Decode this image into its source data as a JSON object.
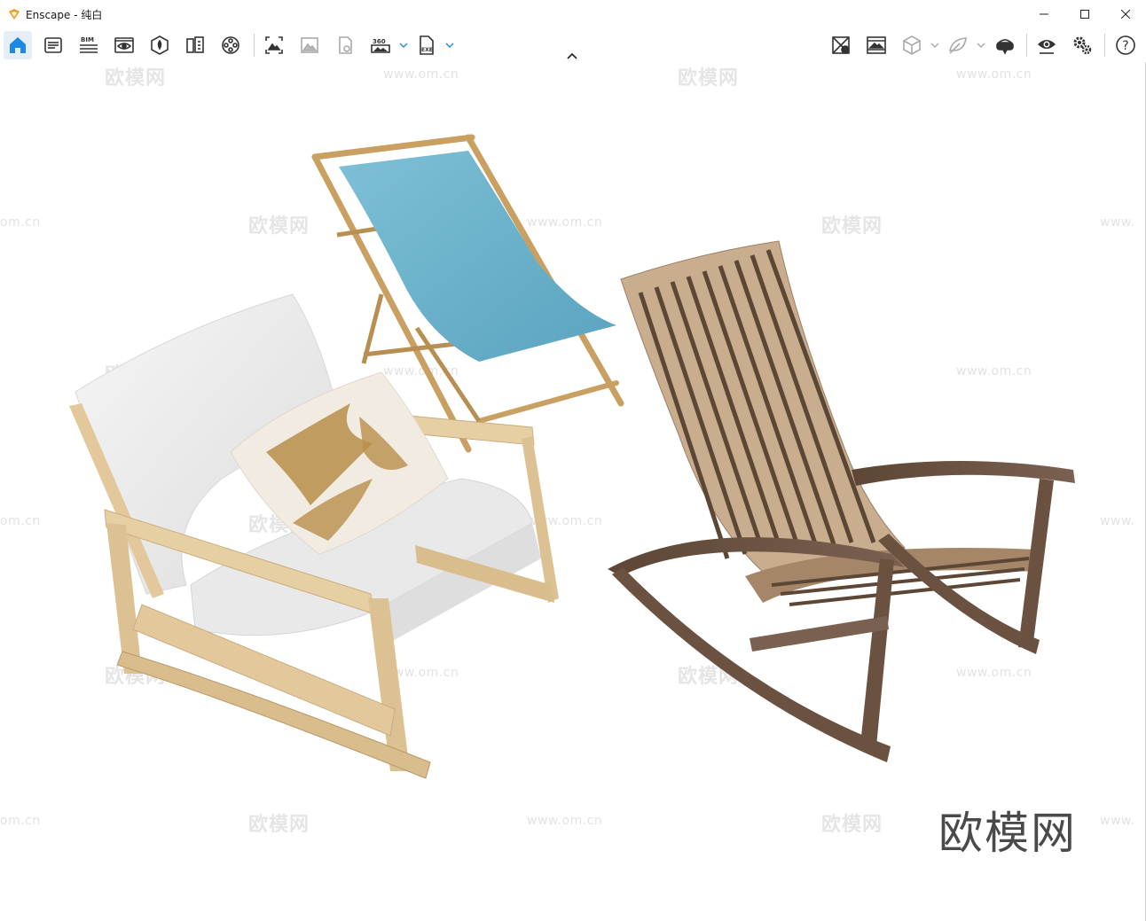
{
  "window": {
    "title": "Enscape - 纯白",
    "controls": [
      "minimize",
      "maximize",
      "close"
    ]
  },
  "toolbar": {
    "left_buttons": [
      {
        "name": "home-icon",
        "active": true
      },
      {
        "name": "asset-library-icon"
      },
      {
        "name": "bim-icon",
        "label": "BIM"
      },
      {
        "name": "view-management-icon"
      },
      {
        "name": "site-context-icon"
      },
      {
        "name": "material-editor-icon"
      },
      {
        "name": "video-editor-icon"
      },
      {
        "name": "screenshot-icon"
      },
      {
        "name": "batch-render-icon"
      },
      {
        "name": "upload-icon"
      },
      {
        "name": "panorama-360-icon",
        "label": "360",
        "has_dropdown": true
      },
      {
        "name": "export-exe-icon",
        "label": "EXE",
        "has_dropdown": true
      }
    ],
    "right_buttons": [
      {
        "name": "sync-views-icon"
      },
      {
        "name": "safe-frame-icon"
      },
      {
        "name": "orthographic-icon",
        "has_dropdown": true
      },
      {
        "name": "light-view-icon",
        "has_dropdown": true
      },
      {
        "name": "vr-headset-icon"
      },
      {
        "name": "visual-settings-icon"
      },
      {
        "name": "general-settings-icon"
      },
      {
        "name": "help-icon"
      }
    ]
  },
  "viewport": {
    "background": "#ffffff",
    "watermark_brand": "欧模网",
    "watermark_url": "www.om.cn",
    "watermark_url_partial": "om.cn",
    "watermark_url_partial_right": "www."
  },
  "colors": {
    "accent": "#1e88e5",
    "canvas_blue": "#7ec0d6",
    "bamboo": "#c9a062",
    "pine": "#e2c89a",
    "cushion": "#eeeeee",
    "walnut": "#6b5240",
    "teak": "#b99a7a"
  }
}
